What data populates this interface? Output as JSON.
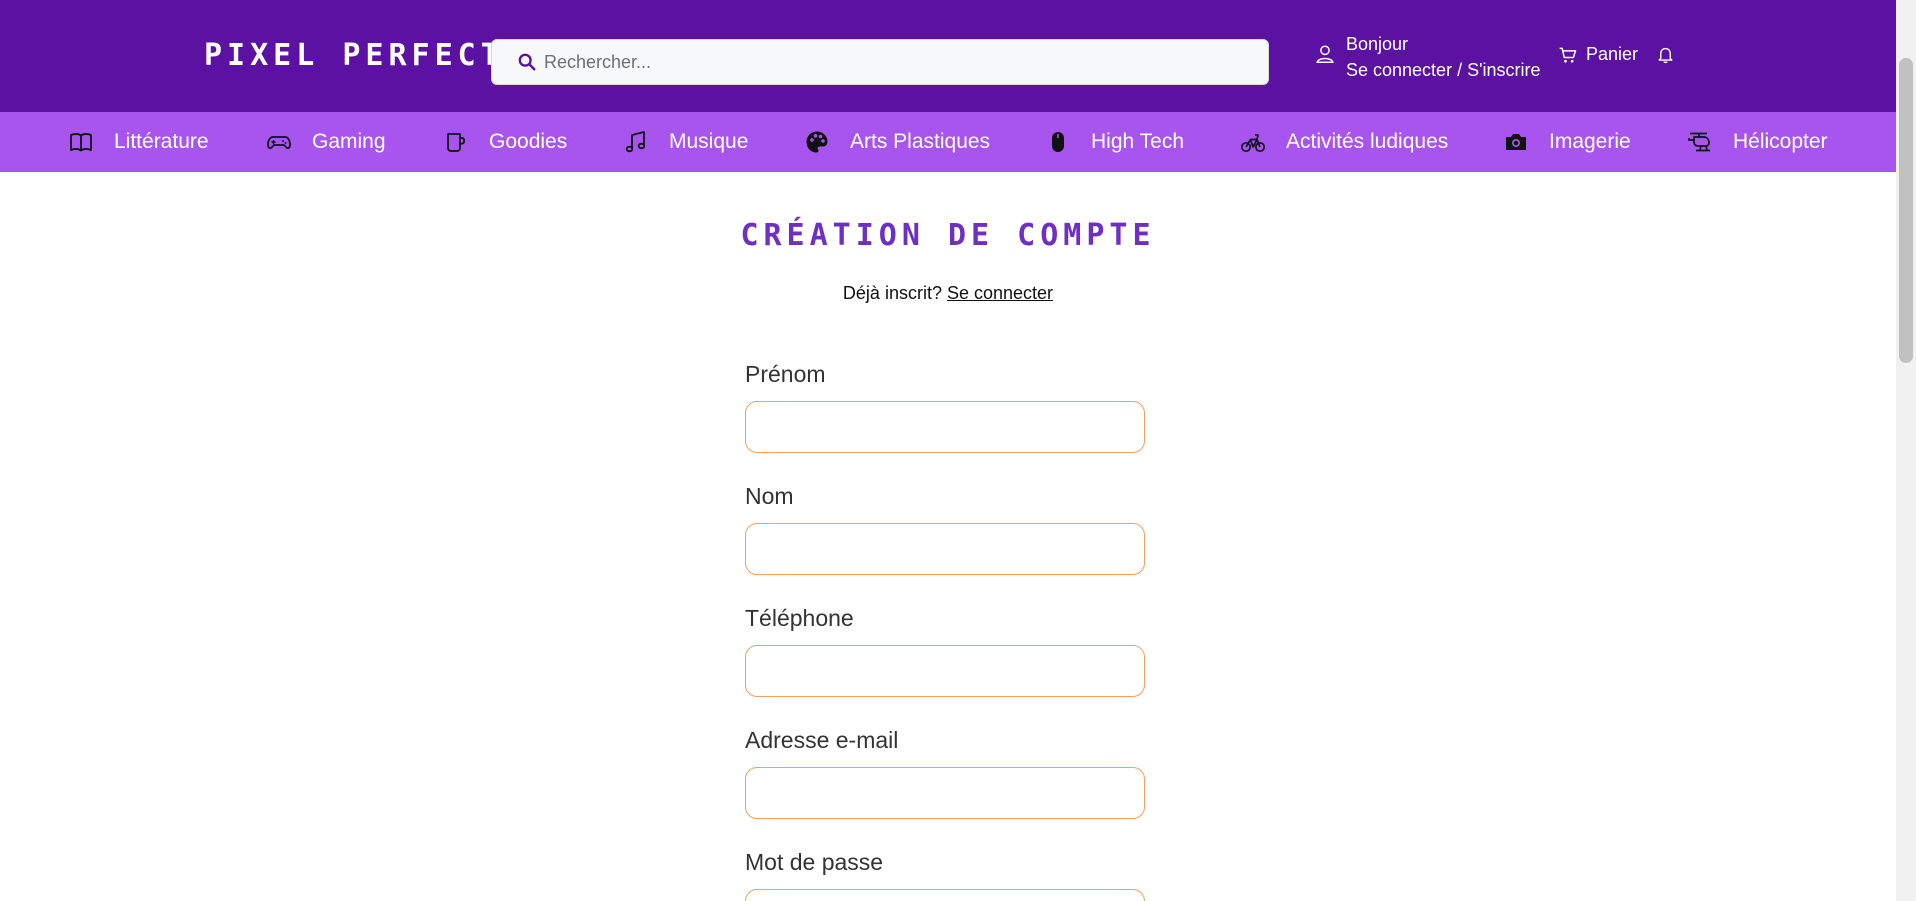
{
  "header": {
    "logo": "PIXEL PERFECT",
    "search_placeholder": "Rechercher...",
    "greeting": "Bonjour",
    "login_link": "Se connecter / S'inscrire",
    "cart_label": "Panier"
  },
  "categories": [
    {
      "label": "Littérature",
      "icon": "book-icon"
    },
    {
      "label": "Gaming",
      "icon": "gamepad-icon"
    },
    {
      "label": "Goodies",
      "icon": "mug-icon"
    },
    {
      "label": "Musique",
      "icon": "music-note-icon"
    },
    {
      "label": "Arts Plastiques",
      "icon": "palette-icon"
    },
    {
      "label": "High Tech",
      "icon": "mouse-icon"
    },
    {
      "label": "Activités ludiques",
      "icon": "bicycle-icon"
    },
    {
      "label": "Imagerie",
      "icon": "camera-icon"
    },
    {
      "label": "Hélicopter",
      "icon": "helicopter-icon"
    }
  ],
  "form": {
    "title": "CRÉATION DE COMPTE",
    "already_text": "Déjà inscrit?",
    "login_link": "Se connecter",
    "fields": [
      {
        "label": "Prénom",
        "value": ""
      },
      {
        "label": "Nom",
        "value": ""
      },
      {
        "label": "Téléphone",
        "value": ""
      },
      {
        "label": "Adresse e-mail",
        "value": ""
      },
      {
        "label": "Mot de passe",
        "value": ""
      }
    ]
  },
  "colors": {
    "header_bg": "#5b12a2",
    "category_bg": "#a855f0",
    "title": "#6d2fc4",
    "input_border": "#f0a060"
  }
}
